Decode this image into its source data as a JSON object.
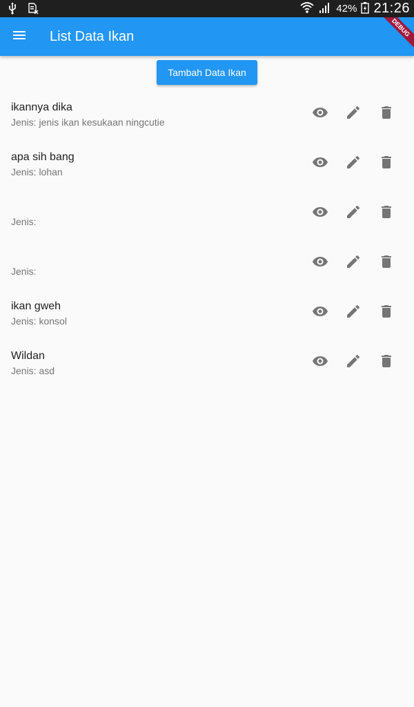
{
  "status_bar": {
    "battery": "42%",
    "time": "21:26",
    "icons": [
      "usb-icon",
      "sim-icon",
      "wifi-icon",
      "signal-icon",
      "battery-icon"
    ]
  },
  "app_bar": {
    "title": "List Data Ikan",
    "menu_icon": "menu-icon",
    "debug_label": "DEBUG",
    "color": "#2196f3"
  },
  "add_button": {
    "label": "Tambah Data Ikan"
  },
  "fish_list": [
    {
      "name": "ikannya dika",
      "type": "Jenis: jenis ikan kesukaan ningcutie"
    },
    {
      "name": "apa sih bang",
      "type": "Jenis: lohan"
    },
    {
      "name": "",
      "type": "Jenis:"
    },
    {
      "name": "",
      "type": "Jenis:"
    },
    {
      "name": "ikan gweh",
      "type": "Jenis: konsol"
    },
    {
      "name": "Wildan",
      "type": "Jenis: asd"
    }
  ],
  "row_actions": [
    "view-icon",
    "edit-icon",
    "delete-icon"
  ]
}
